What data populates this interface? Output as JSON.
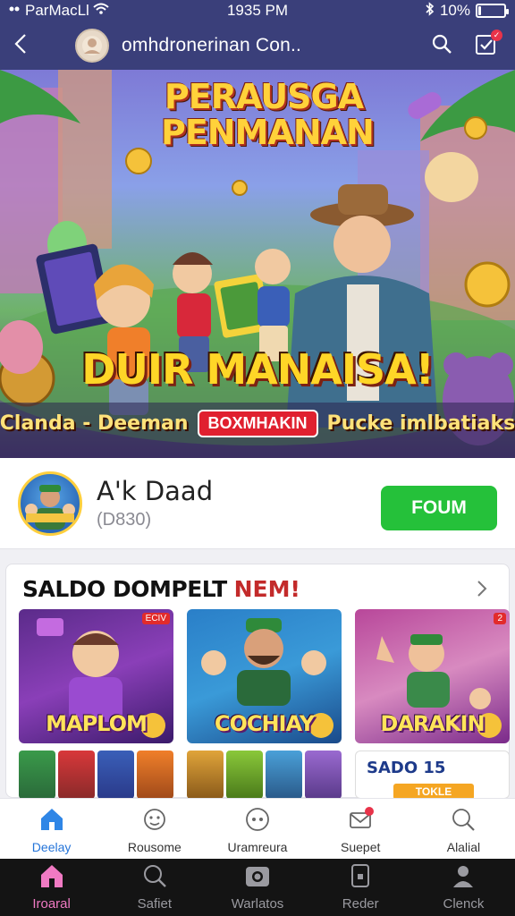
{
  "status_bar": {
    "carrier": "ParMacLl",
    "time": "1935 PM",
    "battery_text": "10%",
    "battery_level": 0.1
  },
  "header": {
    "title": "omhdronerinan Con..",
    "back_icon": "chevron-left-icon",
    "search_icon": "search-icon",
    "notif_icon": "checklist-icon"
  },
  "hero": {
    "title": "PERAUSGA PENMANAN",
    "slogan": "DUIR MANAISA!",
    "sub_left": "Clanda - Deeman",
    "badge": "BOXMHAKIN",
    "sub_right": "Pucke imlbatiaks"
  },
  "profile": {
    "name": "A'k Daad",
    "subtitle": "(D830)",
    "follow_label": "FOUM"
  },
  "section": {
    "title": "SALDO DOMPELT",
    "title_accent": "NEM!",
    "cards": [
      {
        "label": "MAPLOM",
        "tag": "ECIV"
      },
      {
        "label": "COCHIAY",
        "tag": ""
      },
      {
        "label": "DARAKIN",
        "tag": "2"
      }
    ],
    "promo": {
      "text": "SADO 15",
      "button": "TOKLE"
    }
  },
  "tabs": [
    {
      "label": "Deelay",
      "icon": "home-icon"
    },
    {
      "label": "Rousome",
      "icon": "face-icon"
    },
    {
      "label": "Uramreura",
      "icon": "chat-dots-icon"
    },
    {
      "label": "Suepet",
      "icon": "mail-icon"
    },
    {
      "label": "Alalial",
      "icon": "search-icon"
    }
  ],
  "bottom_nav": [
    {
      "label": "Iroaral",
      "icon": "home-icon"
    },
    {
      "label": "Safiet",
      "icon": "search-icon"
    },
    {
      "label": "Warlatos",
      "icon": "camera-icon"
    },
    {
      "label": "Reder",
      "icon": "phone-icon"
    },
    {
      "label": "Clenck",
      "icon": "profile-icon"
    }
  ],
  "colors": {
    "header_bg": "#3a3f7a",
    "follow_green": "#25c13a",
    "active_blue": "#2474d9",
    "active_pink": "#f07ac3",
    "accent_red": "#c32a2a"
  }
}
